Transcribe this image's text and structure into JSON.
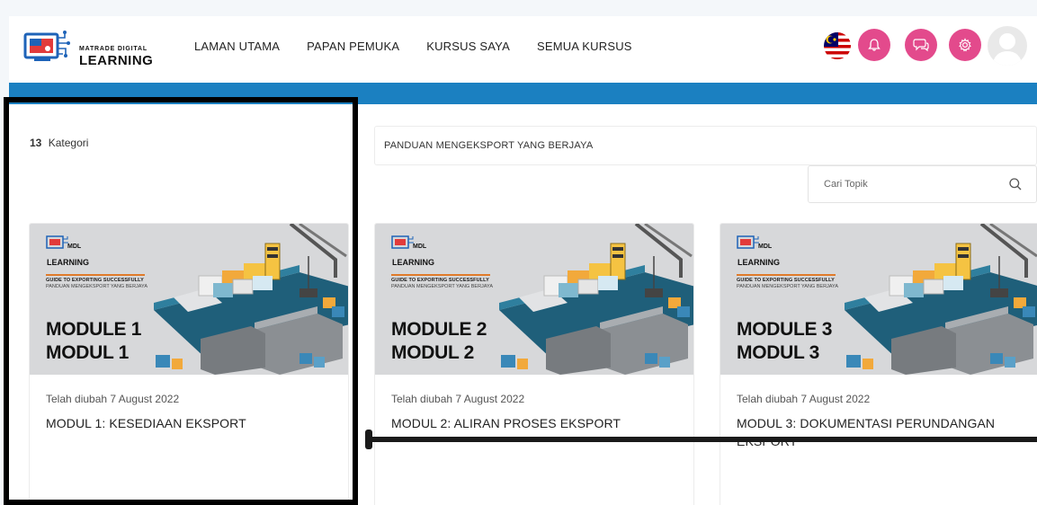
{
  "brand": {
    "logo_small": "MATRADE DIGITAL",
    "logo_big": "LEARNING",
    "colors": {
      "accent_band": "#1b80c1",
      "header_buttons": "#e34a8c"
    }
  },
  "nav": [
    {
      "label": "LAMAN UTAMA"
    },
    {
      "label": "PAPAN PEMUKA"
    },
    {
      "label": "KURSUS SAYA"
    },
    {
      "label": "SEMUA KURSUS"
    }
  ],
  "header_icons": [
    "malaysia-flag-icon",
    "bell-icon",
    "chat-icon",
    "gear-icon",
    "user-avatar-icon"
  ],
  "sidebar": {
    "count": "13",
    "label": "Kategori"
  },
  "breadcrumb": "PANDUAN MENGEKSPORT YANG BERJAYA",
  "search": {
    "placeholder": "Cari Topik",
    "icon": "search-icon"
  },
  "cards": [
    {
      "thumb_mdl": "MDL",
      "thumb_brand": "LEARNING",
      "thumb_guide": "GUIDE TO EXPORTING SUCCESSFULLY",
      "thumb_panduan": "PANDUAN MENGEKSPORT YANG BERJAYA",
      "thumb_module": "MODULE 1",
      "thumb_modul": "MODUL 1",
      "date": "Telah diubah 7 August 2022",
      "title": "MODUL 1: KESEDIAAN EKSPORT"
    },
    {
      "thumb_mdl": "MDL",
      "thumb_brand": "LEARNING",
      "thumb_guide": "GUIDE TO EXPORTING SUCCESSFULLY",
      "thumb_panduan": "PANDUAN MENGEKSPORT YANG BERJAYA",
      "thumb_module": "MODULE 2",
      "thumb_modul": "MODUL 2",
      "date": "Telah diubah 7 August 2022",
      "title": "MODUL 2: ALIRAN PROSES EKSPORT"
    },
    {
      "thumb_mdl": "MDL",
      "thumb_brand": "LEARNING",
      "thumb_guide": "GUIDE TO EXPORTING SUCCESSFULLY",
      "thumb_panduan": "PANDUAN MENGEKSPORT YANG BERJAYA",
      "thumb_module": "MODULE 3",
      "thumb_modul": "MODUL 3",
      "date": "Telah diubah 7 August 2022",
      "title": "MODUL 3: DOKUMENTASI PERUNDANGAN EKSPORT"
    }
  ]
}
